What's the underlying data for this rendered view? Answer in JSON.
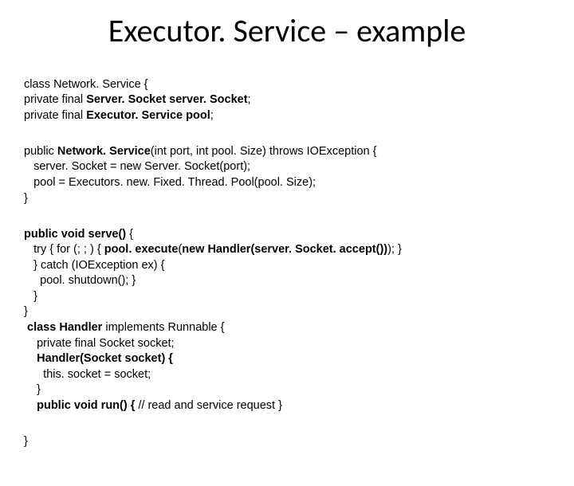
{
  "title": "Executor. Service – example",
  "code": {
    "l1a": "class Network. Service {",
    "l2a": "private final ",
    "l2b": "Server. Socket server. Socket",
    "l2c": ";",
    "l3a": "private final ",
    "l3b": "Executor. Service pool",
    "l3c": ";",
    "l4a": "public ",
    "l4b": "Network. Service",
    "l4c": "(int port, int pool. Size) throws IOException {",
    "l5": "   server. Socket = new Server. Socket(port);",
    "l6": "   pool = Executors. new. Fixed. Thread. Pool(pool. Size);",
    "l7": "}",
    "l8a": "public void serve()",
    "l8b": " {",
    "l9a": "   try { for (; ; ) { ",
    "l9b": "pool. execute",
    "l9c": "(",
    "l9d": "new Handler(server. Socket. accept())",
    "l9e": "); }",
    "l10": "   } catch (IOException ex) {",
    "l11": "     pool. shutdown(); }",
    "l12": "   }",
    "l13": "}",
    "l14a": " class Handler ",
    "l14b": "implements Runnable {",
    "l15": "    private final Socket socket;",
    "l16": "    Handler(Socket socket) {",
    "l17": "      this. socket = socket;",
    "l18": "    }",
    "l19a": "    public void run() { ",
    "l19b": "// read and service request }",
    "l20": "}"
  }
}
